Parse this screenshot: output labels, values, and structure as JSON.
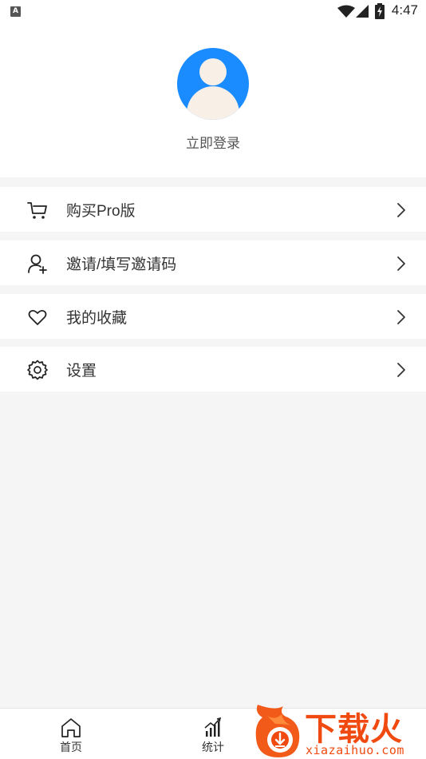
{
  "status_bar": {
    "notification_icon_letter": "A",
    "time": "4:47",
    "icons": [
      "wifi-icon",
      "signal-icon",
      "battery-charging-icon"
    ]
  },
  "profile": {
    "avatar_icon": "user-avatar-icon",
    "login_label": "立即登录"
  },
  "menu": [
    {
      "label": "购买Pro版",
      "icon": "cart-icon"
    },
    {
      "label": "邀请/填写邀请码",
      "icon": "add-user-icon"
    },
    {
      "label": "我的收藏",
      "icon": "heart-icon"
    },
    {
      "label": "设置",
      "icon": "gear-icon"
    }
  ],
  "bottom_nav": [
    {
      "label": "首页",
      "icon": "home-icon"
    },
    {
      "label": "统计",
      "icon": "stats-icon"
    }
  ],
  "watermark": {
    "title": "下载火",
    "url": "xiazaihuo.com"
  },
  "colors": {
    "avatar_blue": "#1a8cff",
    "avatar_skin": "#f8efe6",
    "background": "#f5f5f5",
    "watermark_orange": "#f04a10"
  }
}
